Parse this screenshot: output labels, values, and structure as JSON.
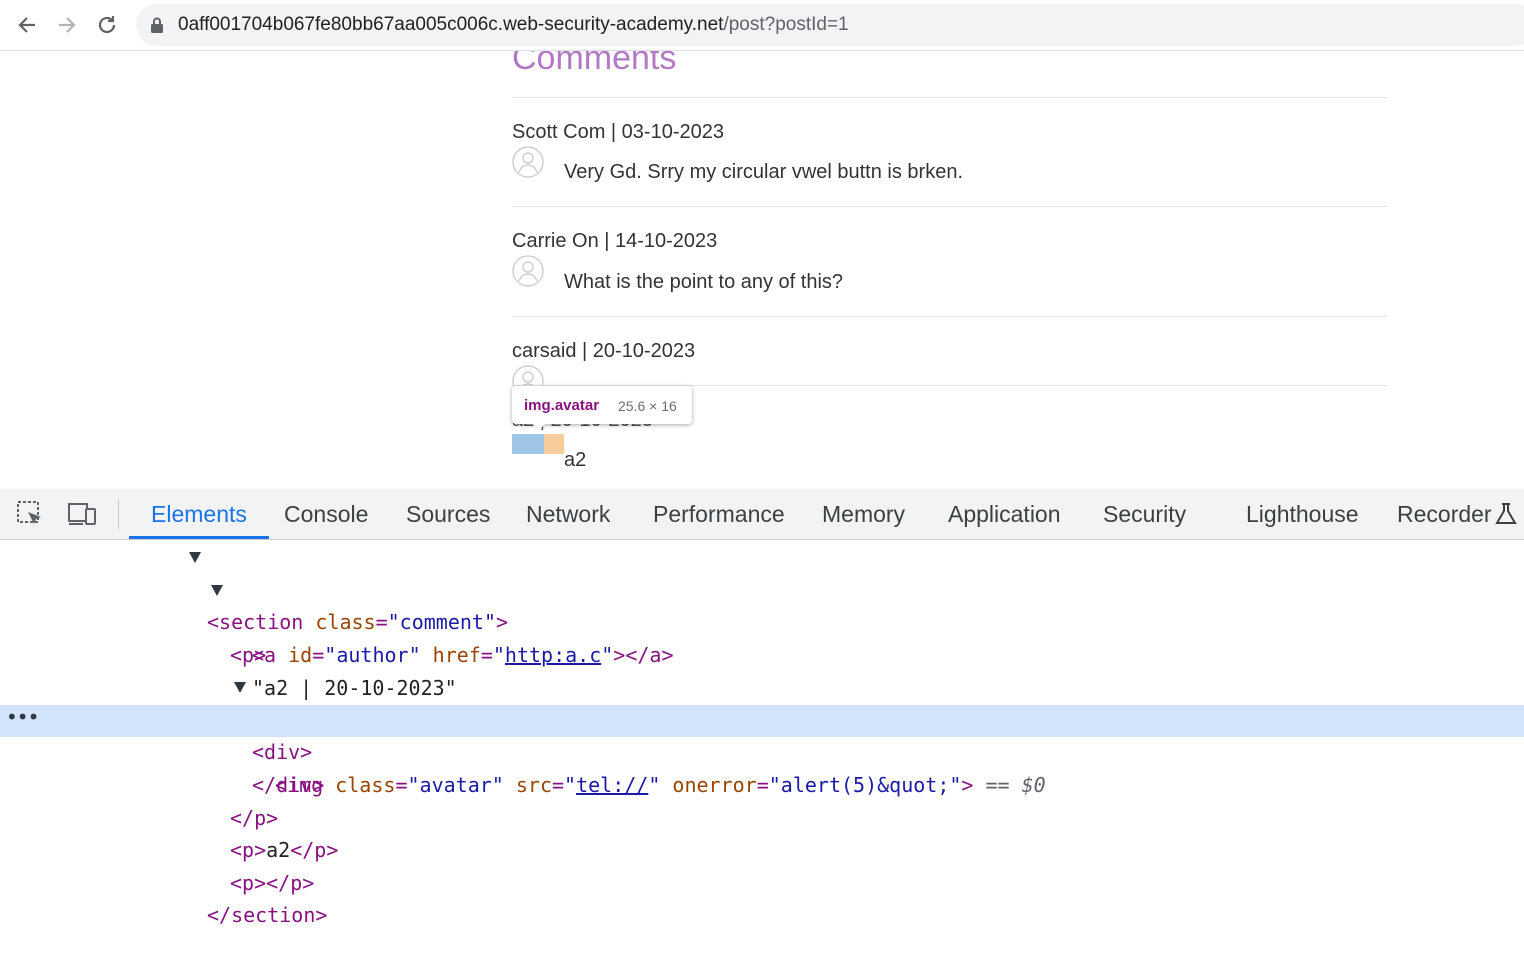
{
  "browser": {
    "url_host": "0aff001704b067fe80bb67aa005c006c.web-security-academy.net",
    "url_path": "/post?postId=1"
  },
  "page": {
    "comments_title": "Comments",
    "comments": [
      {
        "header": "Scott Com | 03-10-2023",
        "body": "Very Gd. Srry my circular vwel buttn is brken."
      },
      {
        "header": "Carrie On | 14-10-2023",
        "body": "What is the point to any of this?"
      },
      {
        "header": "carsaid | 20-10-2023",
        "body": ""
      },
      {
        "header": "a2 | 20-10-2023",
        "body": "a2"
      }
    ],
    "tooltip": {
      "selector": "img.avatar",
      "dimensions": "25.6 × 16"
    }
  },
  "devtools": {
    "tabs": [
      "Elements",
      "Console",
      "Sources",
      "Network",
      "Performance",
      "Memory",
      "Application",
      "Security",
      "Lighthouse",
      "Recorder"
    ],
    "active_tab": "Elements",
    "dom": {
      "section_open_tag": "<section",
      "class_attr": "class",
      "section_class_value": "\"comment\"",
      "close_bracket": ">",
      "p_open": "<p>",
      "a_open": "<a",
      "id_attr": "id",
      "id_value": "\"author\"",
      "href_attr": "href",
      "href_value": "http:a.c",
      "a_close": "></a>",
      "text_node": "\"a2 | 20-10-2023\"",
      "div_open": "<div>",
      "img_open": "<img",
      "img_class_value": "\"avatar\"",
      "src_attr": "src",
      "src_value": "tel://",
      "onerror_attr": "onerror",
      "onerror_value": "\"alert(5)&quot;\"",
      "selected_marker": "== $0",
      "div_close": "</div>",
      "p_close": "</p>",
      "p_a2": "a2",
      "section_close": "</section>",
      "equals": "=",
      "quote": "\""
    }
  },
  "colors": {
    "comments_title": "#b279c6",
    "active_tab": "#1a73e8",
    "selected_row": "#d2e3fc",
    "tag": "#881280",
    "attr_name": "#994500",
    "attr_value": "#1a1aa6"
  }
}
